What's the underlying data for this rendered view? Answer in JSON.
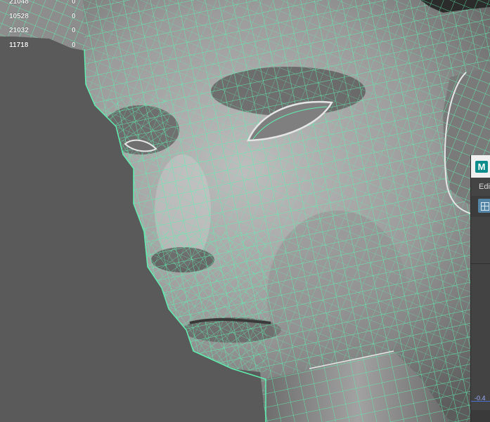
{
  "viewport": {
    "background_color": "#5a5a5a",
    "wireframe_color": "#5ff0b0",
    "selected_edge_color": "#e6e6e6"
  },
  "stats": {
    "rows": [
      {
        "value": "21048",
        "zero": "0"
      },
      {
        "value": "10528",
        "zero": "0"
      },
      {
        "value": "21032",
        "zero": "0"
      },
      {
        "value": "11718",
        "zero": "0"
      }
    ]
  },
  "side_window": {
    "logo": "M",
    "menu_label": "Edi",
    "toolbar_icon": "graph-editor-icon",
    "axis_tick": "-0.4"
  }
}
